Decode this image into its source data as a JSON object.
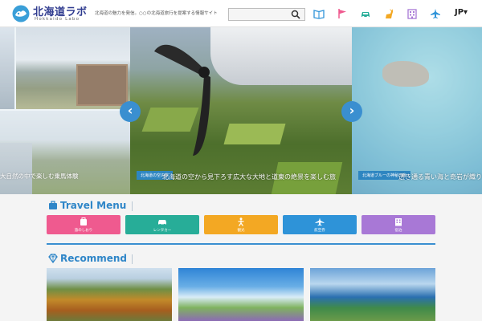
{
  "header": {
    "brand_jp": "北海道ラボ",
    "brand_en": "Hokkaido Labo",
    "tagline": "北海道の魅力を発信。○○の北海道旅行を提案する情報サイト",
    "search_placeholder": "",
    "lang": "JP▾",
    "nav_icons": [
      "guide-book-icon",
      "flag-icon",
      "car-icon",
      "deer-icon",
      "hotel-icon",
      "airplane-icon"
    ]
  },
  "slider": {
    "main_caption_tag": "北海道の空の旅",
    "main_caption_text": "北海道の空から見下ろす広大な大地と道東の絶景を楽しむ旅",
    "right_caption_tag": "北海道ブルーの神秘の海",
    "right_caption_text": "透き通る青い海と奇岩が織りなす絶景の海岸線へ",
    "left_caption_text": "大自然の中で楽しむ乗馬体験",
    "dots_count": 6
  },
  "travel_menu": {
    "title": "Travel Menu",
    "items": [
      {
        "label": "旅のしおり",
        "color": "#ef5a8f",
        "icon": "suitcase-icon"
      },
      {
        "label": "レンタカー",
        "color": "#27ad98",
        "icon": "car-icon"
      },
      {
        "label": "観光",
        "color": "#f3a823",
        "icon": "person-icon"
      },
      {
        "label": "航空券",
        "color": "#2e93d8",
        "icon": "airplane-icon"
      },
      {
        "label": "宿泊",
        "color": "#a878d6",
        "icon": "hotel-icon"
      }
    ]
  },
  "recommend": {
    "title": "Recommend"
  },
  "colors": {
    "accent": "#3a8fd0",
    "brand": "#2f3b8f"
  }
}
